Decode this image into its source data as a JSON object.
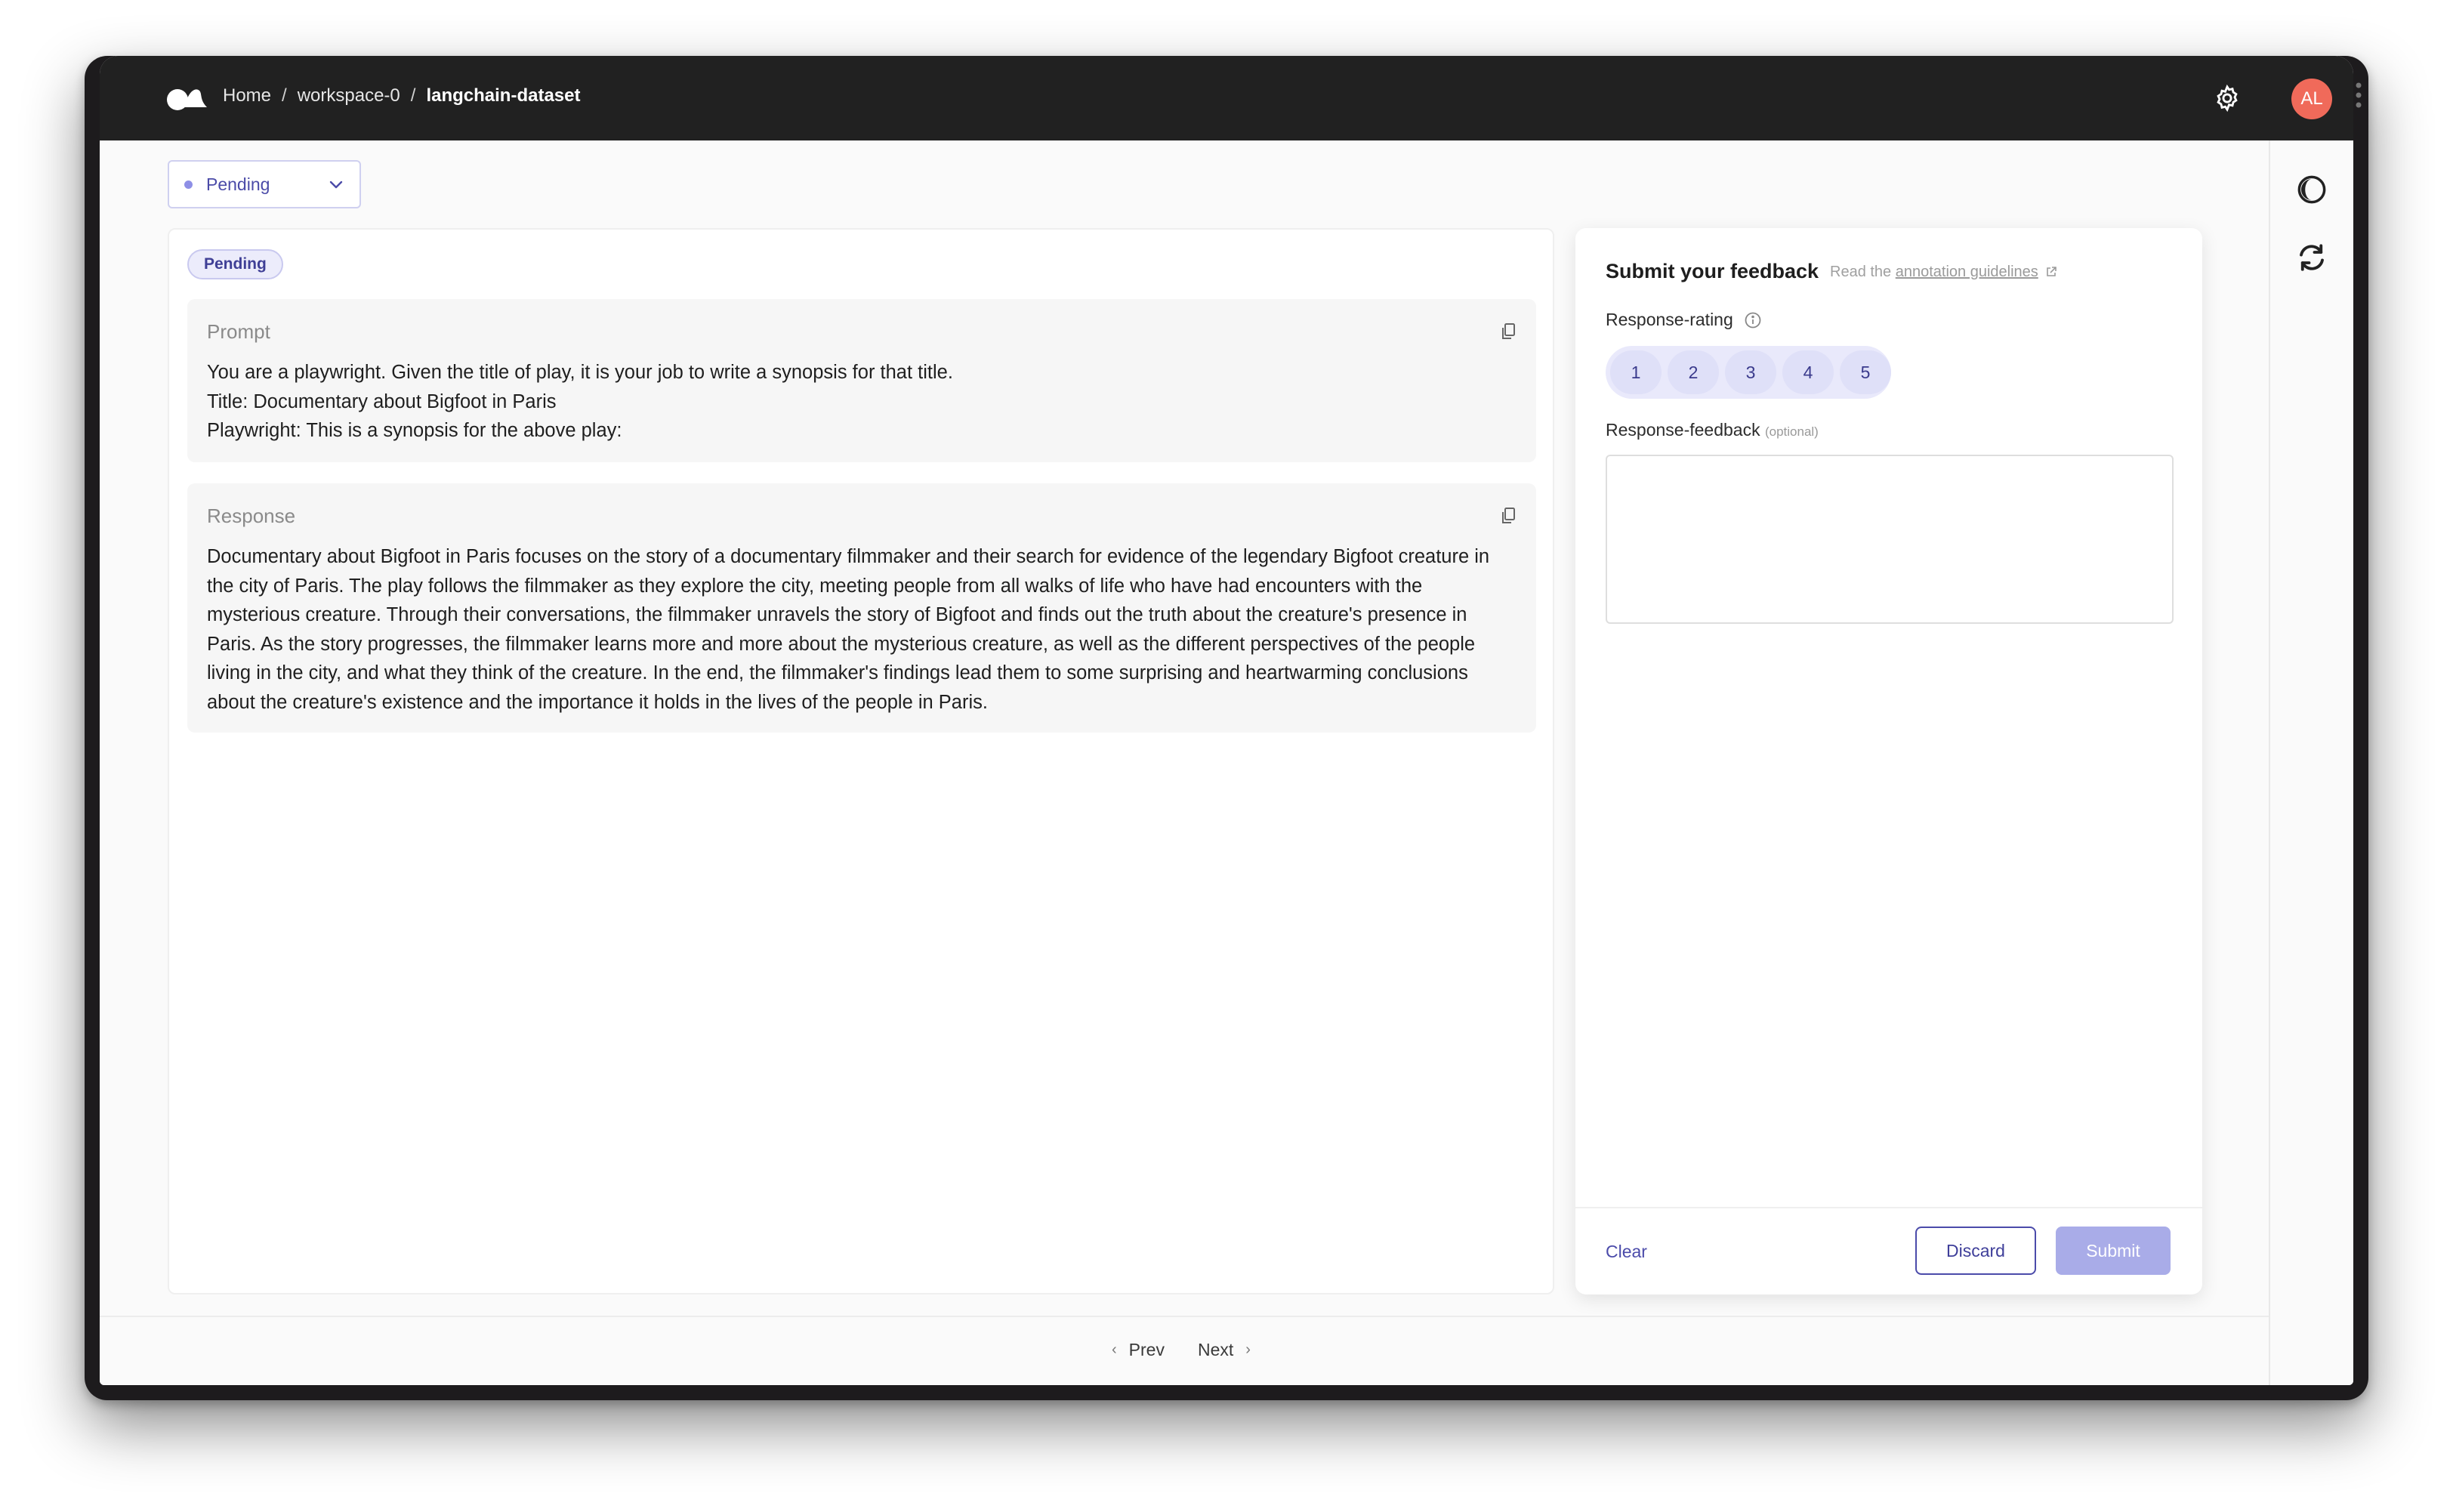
{
  "breadcrumb": {
    "items": [
      "Home",
      "workspace-0",
      "langchain-dataset"
    ],
    "separator": "/"
  },
  "user": {
    "initials": "AL"
  },
  "status_filter": {
    "value": "Pending"
  },
  "record": {
    "status_badge": "Pending",
    "fields": [
      {
        "title": "Prompt",
        "text": "You are a playwright. Given the title of play, it is your job to write a synopsis for that title.\nTitle: Documentary about Bigfoot in Paris\nPlaywright: This is a synopsis for the above play:"
      },
      {
        "title": "Response",
        "text": "Documentary about Bigfoot in Paris focuses on the story of a documentary filmmaker and their search for evidence of the legendary Bigfoot creature in the city of Paris. The play follows the filmmaker as they explore the city, meeting people from all walks of life who have had encounters with the mysterious creature. Through their conversations, the filmmaker unravels the story of Bigfoot and finds out the truth about the creature's presence in Paris. As the story progresses, the filmmaker learns more and more about the mysterious creature, as well as the different perspectives of the people living in the city, and what they think of the creature. In the end, the filmmaker's findings lead them to some surprising and heartwarming conclusions about the creature's existence and the importance it holds in the lives of the people in Paris."
      }
    ]
  },
  "feedback": {
    "title": "Submit your feedback",
    "guidelines_prefix": "Read the",
    "guidelines_link": "annotation guidelines",
    "rating": {
      "label": "Response-rating",
      "options": [
        "1",
        "2",
        "3",
        "4",
        "5"
      ]
    },
    "text_question": {
      "label": "Response-feedback",
      "optional": "(optional)",
      "value": ""
    },
    "clear_label": "Clear",
    "discard_label": "Discard",
    "submit_label": "Submit"
  },
  "pagination": {
    "prev_label": "Prev",
    "next_label": "Next"
  },
  "colors": {
    "accent": "#4b4baa",
    "topbar": "#212121",
    "avatar": "#f06a5a",
    "submit_disabled": "#a9ace8"
  },
  "icons": [
    "app-logo-icon",
    "gear-icon",
    "theme-toggle-icon",
    "refresh-icon",
    "copy-icon",
    "info-icon",
    "external-link-icon",
    "chevron-down-icon"
  ]
}
